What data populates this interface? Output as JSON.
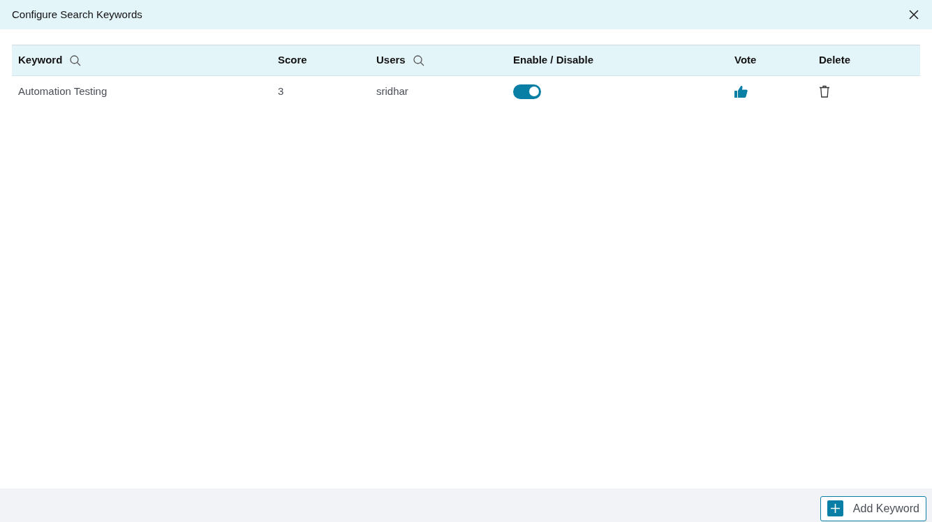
{
  "dialog": {
    "title": "Configure Search Keywords"
  },
  "table": {
    "columns": [
      {
        "label": "Keyword",
        "kind": "search"
      },
      {
        "label": "Score",
        "kind": "plain"
      },
      {
        "label": "Users",
        "kind": "search"
      },
      {
        "label": "Enable / Disable",
        "kind": "plain"
      },
      {
        "label": "Vote",
        "kind": "plain"
      },
      {
        "label": "Delete",
        "kind": "plain"
      }
    ],
    "rows": [
      {
        "keyword": "Automation Testing",
        "score": "3",
        "user": "sridhar",
        "enabled": true
      }
    ]
  },
  "footer": {
    "add_button": "Add Keyword"
  }
}
